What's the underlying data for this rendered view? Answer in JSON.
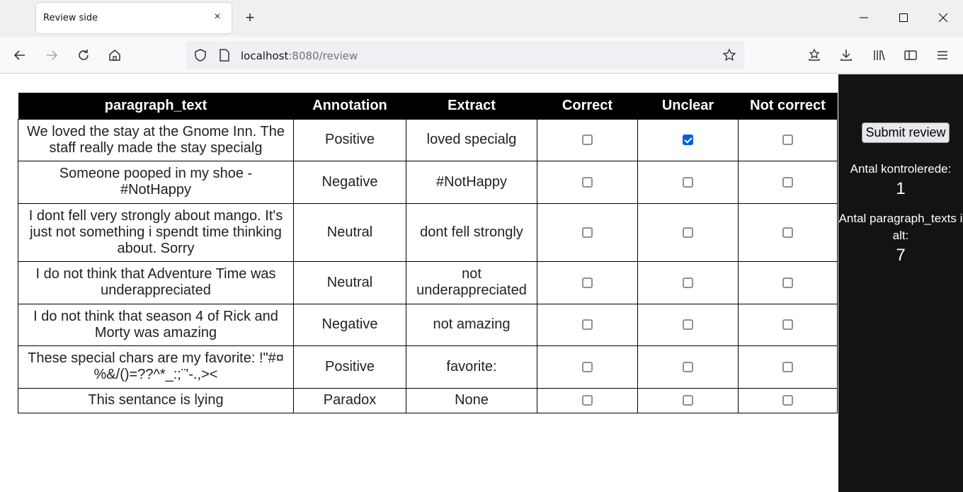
{
  "browser": {
    "tab_title": "Review side",
    "tab_close_icon": "×",
    "new_tab_icon": "+",
    "url_host": "localhost",
    "url_path": ":8080/review"
  },
  "table": {
    "headers": [
      "paragraph_text",
      "Annotation",
      "Extract",
      "Correct",
      "Unclear",
      "Not correct"
    ],
    "rows": [
      {
        "text": "We loved the stay at the Gnome Inn. The staff really made the stay specialg",
        "annotation": "Positive",
        "extract": "loved specialg",
        "correct": false,
        "unclear": true,
        "not_correct": false
      },
      {
        "text": "Someone pooped in my shoe - #NotHappy",
        "annotation": "Negative",
        "extract": "#NotHappy",
        "correct": false,
        "unclear": false,
        "not_correct": false
      },
      {
        "text": "I dont fell very strongly about mango. It's just not something i spendt time thinking about. Sorry",
        "annotation": "Neutral",
        "extract": "dont fell strongly",
        "correct": false,
        "unclear": false,
        "not_correct": false
      },
      {
        "text": "I do not think that Adventure Time was underappreciated",
        "annotation": "Neutral",
        "extract": "not underappreciated",
        "correct": false,
        "unclear": false,
        "not_correct": false
      },
      {
        "text": "I do not think that season 4 of Rick and Morty was amazing",
        "annotation": "Negative",
        "extract": "not amazing",
        "correct": false,
        "unclear": false,
        "not_correct": false
      },
      {
        "text": "These special chars are my favorite: !\"#¤%&/()=??^*_:;¨'-.,><",
        "annotation": "Positive",
        "extract": "favorite:",
        "correct": false,
        "unclear": false,
        "not_correct": false
      },
      {
        "text": "This sentance is lying",
        "annotation": "Paradox",
        "extract": "None",
        "correct": false,
        "unclear": false,
        "not_correct": false
      }
    ]
  },
  "sidebar": {
    "submit_label": "Submit review",
    "checked_label": "Antal kontrolerede:",
    "checked_value": "1",
    "total_label": "Antal paragraph_texts i alt:",
    "total_value": "7"
  },
  "colors": {
    "header_bg": "#000000",
    "sidebar_bg": "#131313",
    "checkbox_checked": "#0060df"
  }
}
